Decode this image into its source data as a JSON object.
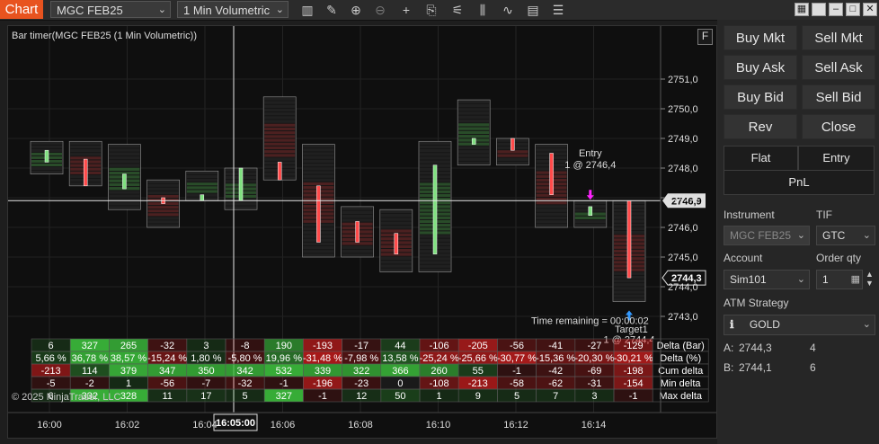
{
  "toolbar": {
    "tab": "Chart",
    "instrument": "MGC FEB25",
    "interval": "1 Min Volumetric",
    "icons": [
      "bar-style-icon",
      "draw-pencil-icon",
      "zoom-in-icon",
      "zoom-out-icon",
      "crosshair-icon",
      "data-box-icon",
      "indicators-icon",
      "strategies-icon",
      "templates-icon",
      "properties-icon"
    ],
    "window_buttons": [
      "grid-icon",
      "restore-icon",
      "minimize-icon",
      "maximize-icon",
      "close-icon"
    ]
  },
  "chart": {
    "title": "Bar timer(MGC FEB25 (1 Min Volumetric))",
    "f_button": "F",
    "price_labels": [
      "2751,0",
      "2750,0",
      "2749,0",
      "2748,0",
      "2747,0",
      "2746,0",
      "2745,0",
      "2744,0",
      "2743,0"
    ],
    "price_values": [
      2751,
      2750,
      2749,
      2748,
      2747,
      2746,
      2745,
      2744,
      2743
    ],
    "crosshair_price": "2746,9",
    "last_price": "2744,3",
    "time_labels": [
      "16:00",
      "16:02",
      "16:04",
      "16:06",
      "16:08",
      "16:10",
      "16:12",
      "16:14"
    ],
    "crosshair_time": "16:05:00",
    "entry_label": "Entry",
    "entry_detail": "1 @ 2746,4",
    "target_label": "Target1",
    "target_detail": "1 @ 2744,4",
    "time_remaining": "Time remaining = 00:00:02",
    "copyright": "© 2025 NinjaTrader, LLC",
    "candles": [
      {
        "o": 2748.2,
        "c": 2748.6,
        "h": 2748.9,
        "l": 2747.8,
        "up": true
      },
      {
        "o": 2748.3,
        "c": 2747.4,
        "h": 2748.9,
        "l": 2747.4,
        "up": false
      },
      {
        "o": 2747.3,
        "c": 2747.8,
        "h": 2748.8,
        "l": 2746.6,
        "up": true
      },
      {
        "o": 2747.0,
        "c": 2746.8,
        "h": 2747.6,
        "l": 2746.0,
        "up": false
      },
      {
        "o": 2746.9,
        "c": 2747.1,
        "h": 2747.9,
        "l": 2746.9,
        "up": true
      },
      {
        "o": 2746.9,
        "c": 2748.0,
        "h": 2748.0,
        "l": 2746.6,
        "up": true
      },
      {
        "o": 2748.2,
        "c": 2747.6,
        "h": 2750.4,
        "l": 2747.6,
        "up": false
      },
      {
        "o": 2747.4,
        "c": 2745.5,
        "h": 2748.8,
        "l": 2745.0,
        "up": false
      },
      {
        "o": 2746.2,
        "c": 2745.5,
        "h": 2746.7,
        "l": 2745.0,
        "up": false
      },
      {
        "o": 2745.8,
        "c": 2745.1,
        "h": 2746.6,
        "l": 2744.5,
        "up": false
      },
      {
        "o": 2745.1,
        "c": 2748.1,
        "h": 2748.9,
        "l": 2744.5,
        "up": true
      },
      {
        "o": 2748.8,
        "c": 2749.0,
        "h": 2750.3,
        "l": 2748.1,
        "up": true
      },
      {
        "o": 2749.0,
        "c": 2748.6,
        "h": 2749.0,
        "l": 2748.1,
        "up": false
      },
      {
        "o": 2748.5,
        "c": 2747.1,
        "h": 2748.8,
        "l": 2746.0,
        "up": false
      },
      {
        "o": 2746.4,
        "c": 2746.7,
        "h": 2746.9,
        "l": 2746.0,
        "up": true
      },
      {
        "o": 2746.9,
        "c": 2744.3,
        "h": 2746.9,
        "l": 2743.5,
        "up": false
      }
    ]
  },
  "chart_data": {
    "type": "table",
    "rows": [
      {
        "name": "Delta (Bar)",
        "values": [
          "6",
          "327",
          "265",
          "-32",
          "3",
          "-8",
          "190",
          "-193",
          "-17",
          "44",
          "-106",
          "-205",
          "-56",
          "-41",
          "-27",
          "-129"
        ],
        "nums": [
          6,
          327,
          265,
          -32,
          3,
          -8,
          190,
          -193,
          -17,
          44,
          -106,
          -205,
          -56,
          -41,
          -27,
          -129
        ]
      },
      {
        "name": "Delta (%)",
        "values": [
          "5,66 %",
          "36,78 %",
          "38,57 %",
          "-15,24 %",
          "1,80 %",
          "-5,80 %",
          "19,96 %",
          "-31,48 %",
          "-7,98 %",
          "13,58 %",
          "-25,24 %",
          "-25,66 %",
          "-30,77 %",
          "-15,36 %",
          "-20,30 %",
          "-30,21 %"
        ],
        "nums": [
          5.66,
          36.78,
          38.57,
          -15.24,
          1.8,
          -5.8,
          19.96,
          -31.48,
          -7.98,
          13.58,
          -25.24,
          -25.66,
          -30.77,
          -15.36,
          -20.3,
          -30.21
        ]
      },
      {
        "name": "Cum delta",
        "values": [
          "-213",
          "114",
          "379",
          "347",
          "350",
          "342",
          "532",
          "339",
          "322",
          "366",
          "260",
          "55",
          "-1",
          "-42",
          "-69",
          "-198"
        ],
        "nums": [
          -213,
          114,
          379,
          347,
          350,
          342,
          532,
          339,
          322,
          366,
          260,
          55,
          -1,
          -42,
          -69,
          -198
        ]
      },
      {
        "name": "Min delta",
        "values": [
          "-5",
          "-2",
          "1",
          "-56",
          "-7",
          "-32",
          "-1",
          "-196",
          "-23",
          "0",
          "-108",
          "-213",
          "-58",
          "-62",
          "-31",
          "-154"
        ],
        "nums": [
          -5,
          -2,
          1,
          -56,
          -7,
          -32,
          -1,
          -196,
          -23,
          0,
          -108,
          -213,
          -58,
          -62,
          -31,
          -154
        ]
      },
      {
        "name": "Max delta",
        "values": [
          "6",
          "332",
          "328",
          "11",
          "17",
          "5",
          "327",
          "-1",
          "12",
          "50",
          "1",
          "9",
          "5",
          "7",
          "3",
          "-1"
        ],
        "nums": [
          6,
          332,
          328,
          11,
          17,
          5,
          327,
          -1,
          12,
          50,
          1,
          9,
          5,
          7,
          3,
          -1
        ]
      }
    ]
  },
  "side": {
    "buttons": [
      {
        "id": "buy-mkt",
        "label": "Buy Mkt"
      },
      {
        "id": "sell-mkt",
        "label": "Sell Mkt"
      },
      {
        "id": "buy-ask",
        "label": "Buy Ask"
      },
      {
        "id": "sell-ask",
        "label": "Sell Ask"
      },
      {
        "id": "buy-bid",
        "label": "Buy Bid"
      },
      {
        "id": "sell-bid",
        "label": "Sell Bid"
      },
      {
        "id": "rev",
        "label": "Rev"
      },
      {
        "id": "close",
        "label": "Close"
      }
    ],
    "flat": "Flat",
    "entry": "Entry",
    "pnl": "PnL",
    "instrument_label": "Instrument",
    "instrument_value": "MGC FEB25",
    "tif_label": "TIF",
    "tif_value": "GTC",
    "account_label": "Account",
    "account_value": "Sim101",
    "orderqty_label": "Order qty",
    "orderqty_value": "1",
    "atm_label": "ATM Strategy",
    "atm_value": "GOLD",
    "ask_label": "A:",
    "ask_price": "2744,3",
    "ask_size": "4",
    "bid_label": "B:",
    "bid_price": "2744,1",
    "bid_size": "6"
  }
}
